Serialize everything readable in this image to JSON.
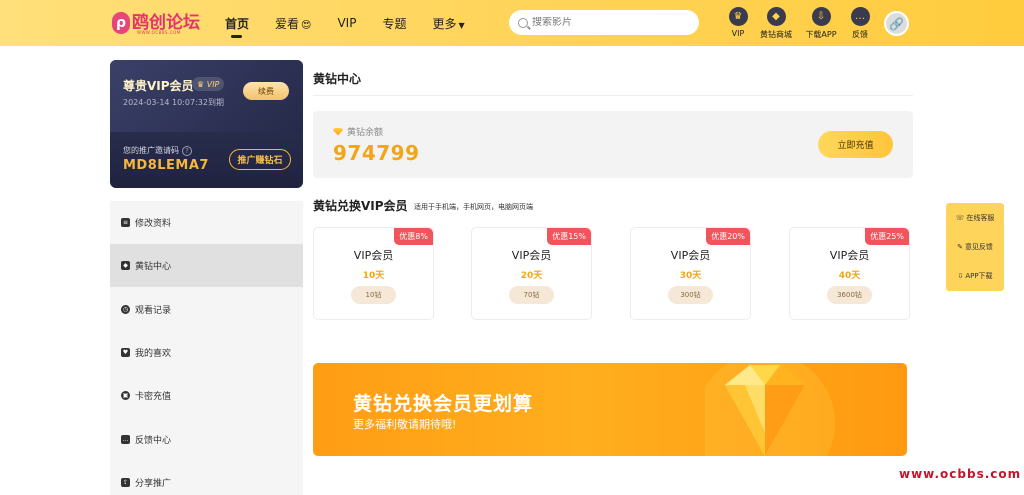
{
  "brand": {
    "logo_mark": "ρ",
    "logo_text": "鸥创论坛",
    "logo_sub": "WWW.OCBBS.COM"
  },
  "nav": {
    "items": [
      {
        "label": "首页",
        "active": true
      },
      {
        "label": "爱看",
        "emoji": "😍"
      },
      {
        "label": "VIP"
      },
      {
        "label": "专题"
      },
      {
        "label": "更多",
        "caret": "▼"
      }
    ]
  },
  "search": {
    "placeholder": "搜索影片"
  },
  "header_actions": [
    {
      "label": "VIP",
      "icon": "crown-icon",
      "glyph": "♛"
    },
    {
      "label": "黄钻商城",
      "icon": "diamond-icon",
      "glyph": "◆"
    },
    {
      "label": "下载APP",
      "icon": "download-icon",
      "glyph": "⇩"
    },
    {
      "label": "反馈",
      "icon": "feedback-icon",
      "glyph": "…"
    }
  ],
  "avatar": {
    "glyph": "🔗"
  },
  "member_card": {
    "title": "尊贵VIP会员",
    "tag": "VIP",
    "expire": "2024-03-14 10:07:32到期",
    "renew": "续费",
    "invite_label": "您的推广邀请码",
    "invite_code": "MD8LEMA7",
    "promote": "推广赚钻石"
  },
  "menu": {
    "items": [
      {
        "label": "修改资料",
        "icon": "edit-icon",
        "glyph": "≡"
      },
      {
        "label": "黄钻中心",
        "icon": "diamond-icon",
        "glyph": "◆",
        "active": true
      },
      {
        "label": "观看记录",
        "icon": "clock-icon",
        "glyph": "◷"
      },
      {
        "label": "我的喜欢",
        "icon": "thumb-icon",
        "glyph": "♥"
      },
      {
        "label": "卡密充值",
        "icon": "card-icon",
        "glyph": "▣"
      },
      {
        "label": "反馈中心",
        "icon": "message-icon",
        "glyph": "…"
      },
      {
        "label": "分享推广",
        "icon": "share-icon",
        "glyph": "⇪"
      }
    ]
  },
  "content": {
    "title": "黄钻中心",
    "balance_label": "黄钻余额",
    "balance_value": "974799",
    "recharge": "立即充值",
    "exchange_title": "黄钻兑换VIP会员",
    "exchange_sub": "适用于手机端，手机网页，电脑网页端"
  },
  "packages": [
    {
      "badge": "优惠8%",
      "name": "VIP会员",
      "days": "10天",
      "price": "10钻"
    },
    {
      "badge": "优惠15%",
      "name": "VIP会员",
      "days": "20天",
      "price": "70钻"
    },
    {
      "badge": "优惠20%",
      "name": "VIP会员",
      "days": "30天",
      "price": "300钻"
    },
    {
      "badge": "优惠25%",
      "name": "VIP会员",
      "days": "40天",
      "price": "3600钻"
    }
  ],
  "banner": {
    "title": "黄钻兑换会员更划算",
    "subtitle": "更多福利敬请期待哦!"
  },
  "float_panel": {
    "items": [
      {
        "label": "在线客服",
        "glyph": "☏"
      },
      {
        "label": "意见反馈",
        "glyph": "✎"
      },
      {
        "label": "APP下载",
        "glyph": "⇩"
      }
    ]
  },
  "watermark": "www.ocbbs.com",
  "colors": {
    "accent": "#ffd45a",
    "price": "#f2a51a",
    "badge": "#f2545b",
    "card_dark": "#262a4a"
  }
}
